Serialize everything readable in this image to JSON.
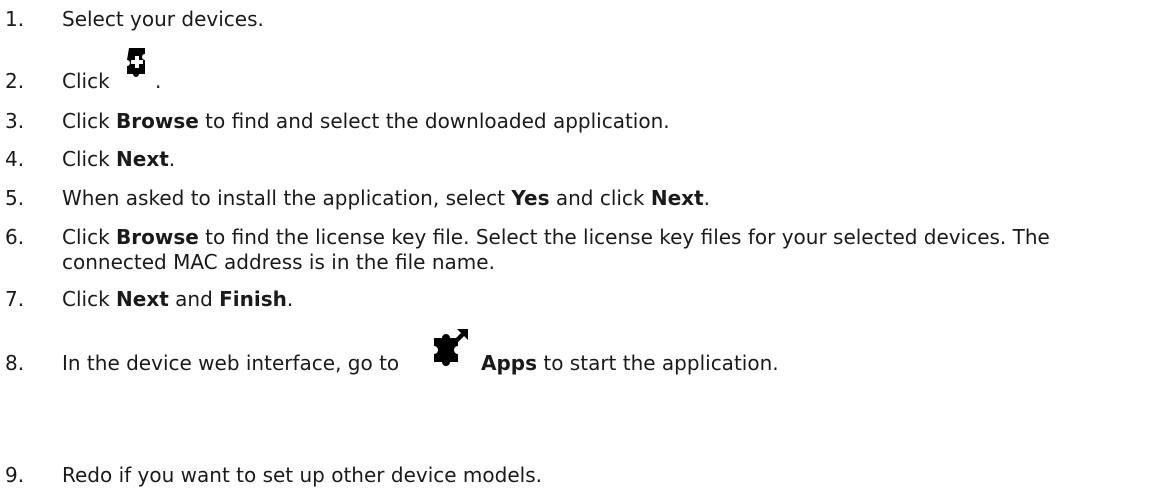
{
  "steps": [
    {
      "num": "1.",
      "parts": [
        "Select your devices."
      ]
    },
    {
      "num": "2.",
      "parts": [
        "Click",
        "."
      ],
      "icon": "puzzle-plus-icon"
    },
    {
      "num": "3.",
      "parts": [
        "Click ",
        "Browse",
        " to find and select the downloaded application."
      ]
    },
    {
      "num": "4.",
      "parts": [
        "Click ",
        "Next",
        "."
      ]
    },
    {
      "num": "5.",
      "parts": [
        "When asked to install the application, select ",
        "Yes",
        " and click ",
        "Next",
        "."
      ]
    },
    {
      "num": "6.",
      "parts": [
        "Click ",
        "Browse",
        " to find the license key file. Select the license key files for your selected devices. The",
        "connected MAC address is in the file name."
      ]
    },
    {
      "num": "7.",
      "parts": [
        "Click ",
        "Next",
        " and ",
        "Finish",
        "."
      ]
    },
    {
      "num": "8.",
      "parts": [
        "In the device web interface, go to ",
        "Apps",
        " to start the application."
      ],
      "icon": "apps-puzzle-icon"
    },
    {
      "num": "9.",
      "parts": [
        "Redo if you want to set up other device models."
      ]
    }
  ]
}
